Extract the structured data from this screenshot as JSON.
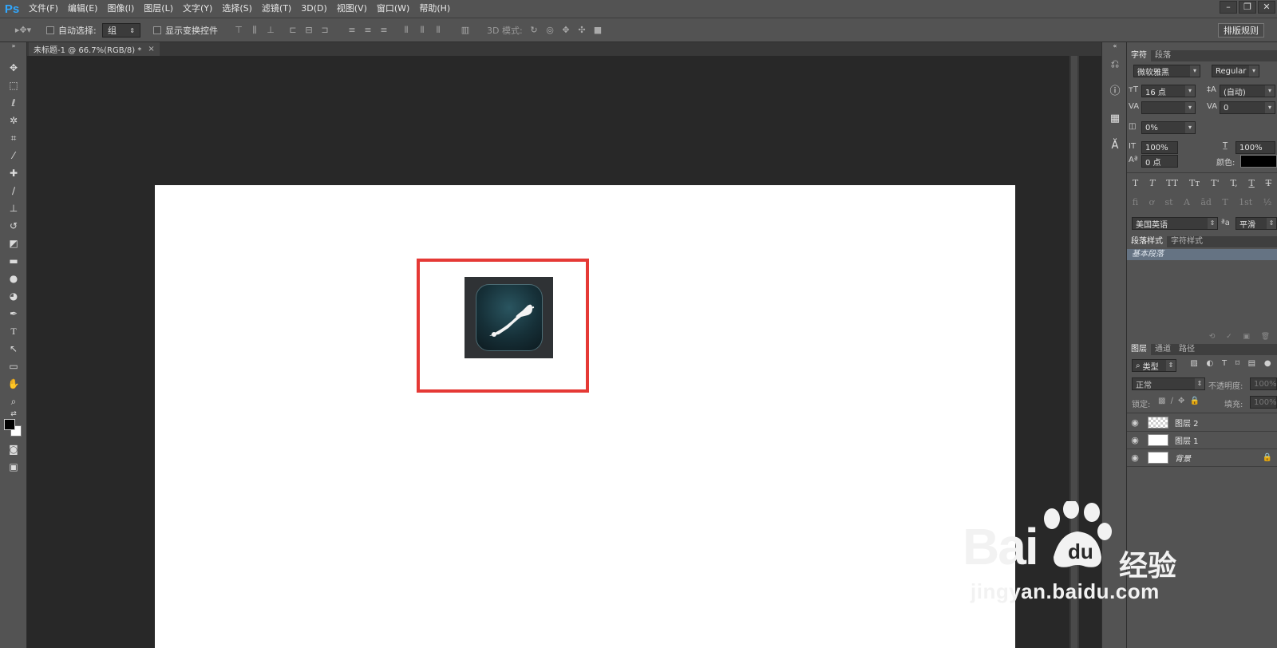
{
  "app": {
    "logo": "Ps"
  },
  "menubar": {
    "items": [
      "文件(F)",
      "编辑(E)",
      "图像(I)",
      "图层(L)",
      "文字(Y)",
      "选择(S)",
      "滤镜(T)",
      "3D(D)",
      "视图(V)",
      "窗口(W)",
      "帮助(H)"
    ],
    "window_controls": [
      "–",
      "❐",
      "✕"
    ]
  },
  "options": {
    "auto_select_label": "自动选择:",
    "auto_select_value": "组",
    "show_transform_label": "显示变换控件",
    "mode_3d_label": "3D 模式:",
    "workspace_button": "排版规则"
  },
  "document": {
    "tab_title": "未标题-1 @ 66.7%(RGB/8) *",
    "close": "×"
  },
  "character_panel": {
    "tabs": [
      "字符",
      "段落"
    ],
    "font_family": "微软雅黑",
    "font_style": "Regular",
    "font_size": "16 点",
    "leading": "(自动)",
    "kerning": "",
    "tracking": "0",
    "scale_percent": "0%",
    "vertical_scale": "100%",
    "horizontal_scale": "100%",
    "baseline_shift": "0 点",
    "color_label": "颜色:",
    "style_glyphs": [
      "T",
      "T",
      "TT",
      "Tт",
      "T'",
      "T,",
      "T",
      "T"
    ],
    "opentype_glyphs": [
      "fi",
      "ơ",
      "st",
      "A",
      "ād",
      "T",
      "1st",
      "½"
    ],
    "language": "美国英语",
    "aa_label": "ªa",
    "antialias": "平滑"
  },
  "styles_panel": {
    "tabs": [
      "段落样式",
      "字符样式"
    ],
    "items": [
      "基本段落"
    ]
  },
  "layers_panel": {
    "tabs": [
      "图层",
      "通道",
      "路径"
    ],
    "filter_kind": "类型",
    "blend_mode": "正常",
    "opacity_label": "不透明度:",
    "opacity": "100%",
    "lock_label": "锁定:",
    "fill_label": "填充:",
    "fill": "100%",
    "layers": [
      {
        "name": "图层 2",
        "thumb": "checker",
        "italic": false,
        "locked": false
      },
      {
        "name": "图层 1",
        "thumb": "white",
        "italic": false,
        "locked": false
      },
      {
        "name": "背景",
        "thumb": "white",
        "italic": true,
        "locked": true
      }
    ]
  },
  "watermark": {
    "brand": "Bai",
    "brand2": "经验",
    "url": "jingyan.baidu.com"
  },
  "colors": {
    "highlight": "#e53935",
    "ps_blue": "#31a8ff",
    "annotation_arrow": "#e53935"
  }
}
